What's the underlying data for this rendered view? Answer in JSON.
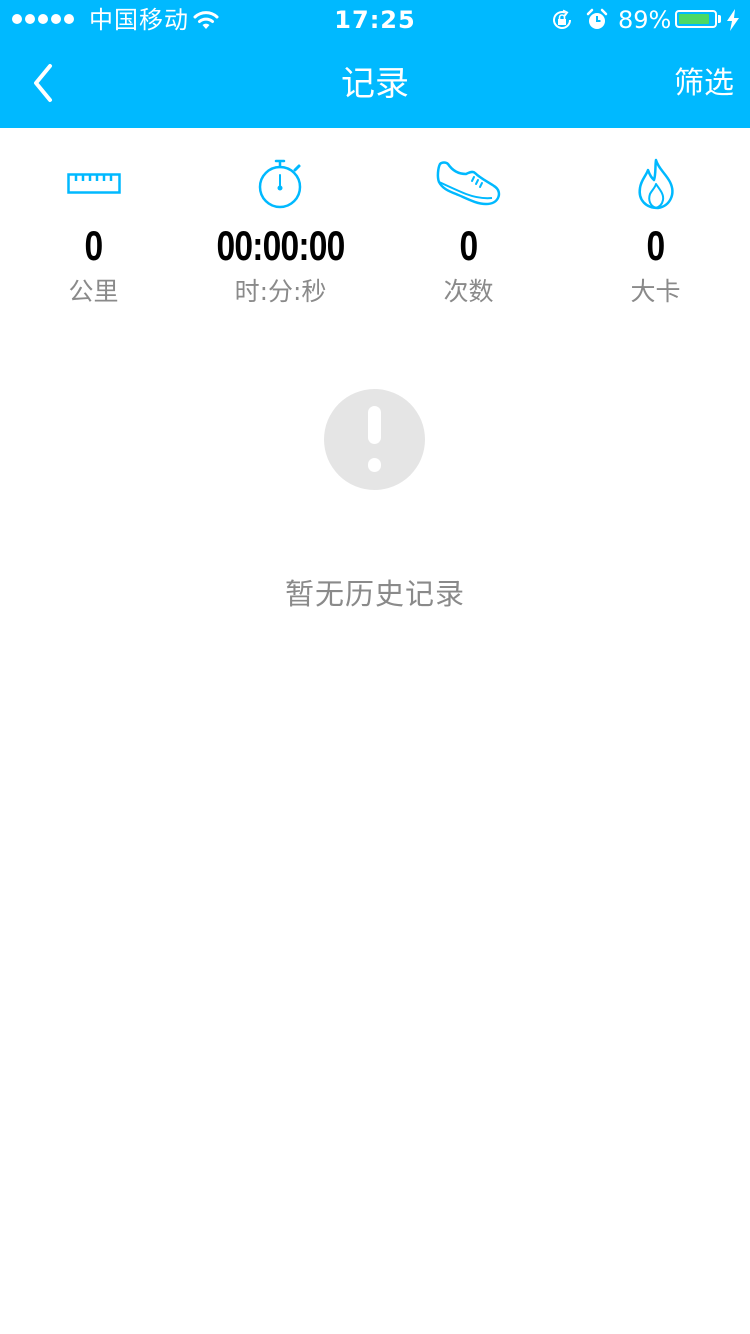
{
  "status_bar": {
    "carrier": "中国移动",
    "time": "17:25",
    "battery_percent_label": "89%",
    "battery_level": 0.89,
    "signal_bars": 5
  },
  "nav": {
    "title": "记录",
    "filter_label": "筛选",
    "back_icon": "chevron-left-icon"
  },
  "stats": [
    {
      "icon": "ruler-icon",
      "value": "0",
      "label": "公里"
    },
    {
      "icon": "stopwatch-icon",
      "value": "00:00:00",
      "label": "时:分:秒"
    },
    {
      "icon": "shoe-icon",
      "value": "0",
      "label": "次数"
    },
    {
      "icon": "flame-icon",
      "value": "0",
      "label": "大卡"
    }
  ],
  "empty_state": {
    "icon": "exclamation-icon",
    "message": "暂无历史记录"
  },
  "colors": {
    "accent": "#00b9ff",
    "battery": "#4cd964",
    "label_gray": "#8a8a8a",
    "empty_icon_bg": "#e5e5e5"
  }
}
